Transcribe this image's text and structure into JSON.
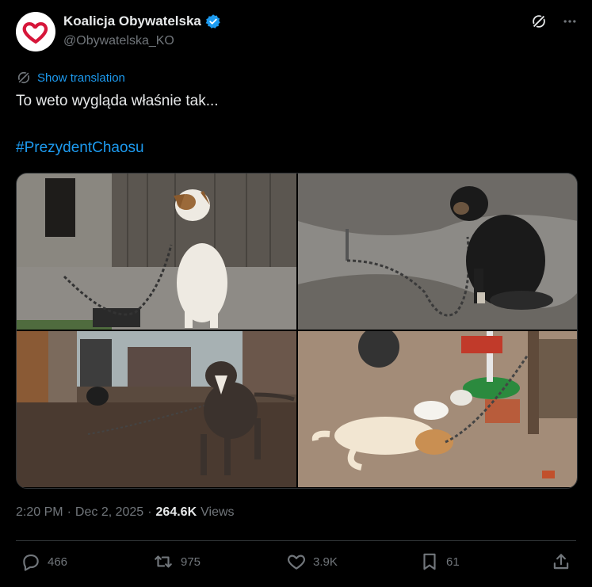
{
  "author": {
    "name": "Koalicja Obywatelska",
    "handle": "@Obywatelska_KO",
    "verified": true,
    "avatar_icon": "heart-icon",
    "avatar_color": "#d6163a"
  },
  "translate": {
    "label": "Show translation"
  },
  "tweet": {
    "text": "To weto wygląda właśnie tak...",
    "hashtag": "#PrezydentChaosu"
  },
  "media": {
    "photos": [
      {
        "name": "photo-dog-chained-by-shed"
      },
      {
        "name": "photo-black-dog-chained-muddy-yard"
      },
      {
        "name": "photo-dog-chained-in-yard"
      },
      {
        "name": "photo-dog-lying-on-concrete"
      }
    ]
  },
  "meta": {
    "time": "2:20 PM",
    "date": "Dec 2, 2025",
    "separator": "·",
    "views_count": "264.6K",
    "views_label": "Views"
  },
  "actions": {
    "replies": "466",
    "reposts": "975",
    "likes": "3.9K",
    "bookmarks": "61"
  },
  "colors": {
    "background": "#000000",
    "text": "#e7e9ea",
    "muted": "#71767b",
    "accent": "#1d9bf0",
    "divider": "#2f3336"
  }
}
